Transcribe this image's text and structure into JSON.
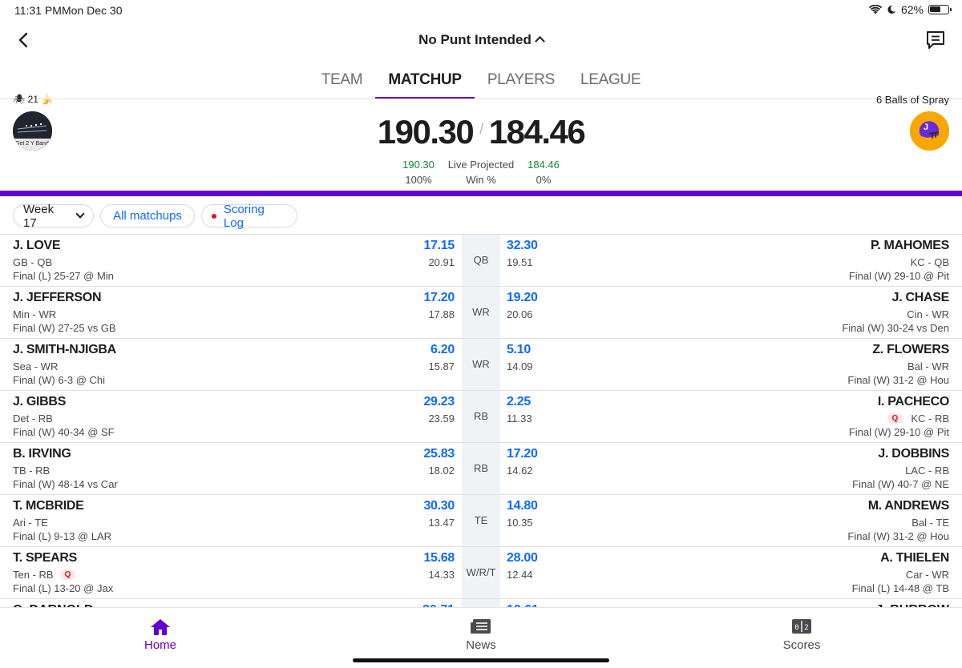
{
  "status_bar": {
    "time": "11:31 PM",
    "date": "Mon Dec 30",
    "battery": "62%",
    "battery_level": 0.62
  },
  "header": {
    "title": "No Punt Intended"
  },
  "tabs": [
    {
      "label": "TEAM",
      "active": false
    },
    {
      "label": "MATCHUP",
      "active": true
    },
    {
      "label": "PLAYERS",
      "active": false
    },
    {
      "label": "LEAGUE",
      "active": false
    }
  ],
  "matchup": {
    "left_team": {
      "name_partial": "21",
      "avatar_text": "Get 2 Y Band",
      "score": "190.30",
      "projected": "190.30",
      "win_pct": "100%"
    },
    "right_team": {
      "name": "6 Balls of Spray",
      "avatar_text": "J",
      "score": "184.46",
      "projected": "184.46",
      "win_pct": "0%"
    },
    "projected_label": "Live Projected",
    "win_label": "Win %",
    "win_fraction": 1.0,
    "colors": {
      "accent": "#6001d2",
      "link": "#0f69ff",
      "positive": "#188433"
    }
  },
  "filters": {
    "week": "Week 17",
    "all_matchups": "All matchups",
    "scoring_log": "Scoring Log"
  },
  "rows": [
    {
      "pos": "QB",
      "left": {
        "name": "J. LOVE",
        "team": "GB - QB",
        "game": "Final (L) 25-27 @ Min",
        "pts": "17.15",
        "proj": "20.91",
        "q": ""
      },
      "right": {
        "name": "P. MAHOMES",
        "team": "KC - QB",
        "game": "Final (W) 29-10 @ Pit",
        "pts": "32.30",
        "proj": "19.51",
        "q": ""
      }
    },
    {
      "pos": "WR",
      "left": {
        "name": "J. JEFFERSON",
        "team": "Min - WR",
        "game": "Final (W) 27-25 vs GB",
        "pts": "17.20",
        "proj": "17.88",
        "q": ""
      },
      "right": {
        "name": "J. CHASE",
        "team": "Cin - WR",
        "game": "Final (W) 30-24 vs Den",
        "pts": "19.20",
        "proj": "20.06",
        "q": ""
      }
    },
    {
      "pos": "WR",
      "left": {
        "name": "J. SMITH-NJIGBA",
        "team": "Sea - WR",
        "game": "Final (W) 6-3 @ Chi",
        "pts": "6.20",
        "proj": "15.87",
        "q": ""
      },
      "right": {
        "name": "Z. FLOWERS",
        "team": "Bal - WR",
        "game": "Final (W) 31-2 @ Hou",
        "pts": "5.10",
        "proj": "14.09",
        "q": ""
      }
    },
    {
      "pos": "RB",
      "left": {
        "name": "J. GIBBS",
        "team": "Det - RB",
        "game": "Final (W) 40-34 @ SF",
        "pts": "29.23",
        "proj": "23.59",
        "q": ""
      },
      "right": {
        "name": "I. PACHECO",
        "team": "KC - RB",
        "game": "Final (W) 29-10 @ Pit",
        "pts": "2.25",
        "proj": "11.33",
        "q": "Q"
      }
    },
    {
      "pos": "RB",
      "left": {
        "name": "B. IRVING",
        "team": "TB - RB",
        "game": "Final (W) 48-14 vs Car",
        "pts": "25.83",
        "proj": "18.02",
        "q": ""
      },
      "right": {
        "name": "J. DOBBINS",
        "team": "LAC - RB",
        "game": "Final (W) 40-7 @ NE",
        "pts": "17.20",
        "proj": "14.62",
        "q": ""
      }
    },
    {
      "pos": "TE",
      "left": {
        "name": "T. MCBRIDE",
        "team": "Ari - TE",
        "game": "Final (L) 9-13 @ LAR",
        "pts": "30.30",
        "proj": "13.47",
        "q": ""
      },
      "right": {
        "name": "M. ANDREWS",
        "team": "Bal - TE",
        "game": "Final (W) 31-2 @ Hou",
        "pts": "14.80",
        "proj": "10.35",
        "q": ""
      }
    },
    {
      "pos": "W/R/T",
      "left": {
        "name": "T. SPEARS",
        "team": "Ten - RB",
        "game": "Final (L) 13-20 @ Jax",
        "pts": "15.68",
        "proj": "14.33",
        "q": "Q"
      },
      "right": {
        "name": "A. THIELEN",
        "team": "Car - WR",
        "game": "Final (L) 14-48 @ TB",
        "pts": "28.00",
        "proj": "12.44",
        "q": ""
      }
    }
  ],
  "bottom_nav": [
    {
      "label": "Home",
      "icon": "home-icon",
      "active": true
    },
    {
      "label": "News",
      "icon": "news-icon",
      "active": false
    },
    {
      "label": "Scores",
      "icon": "scores-icon",
      "active": false
    }
  ]
}
